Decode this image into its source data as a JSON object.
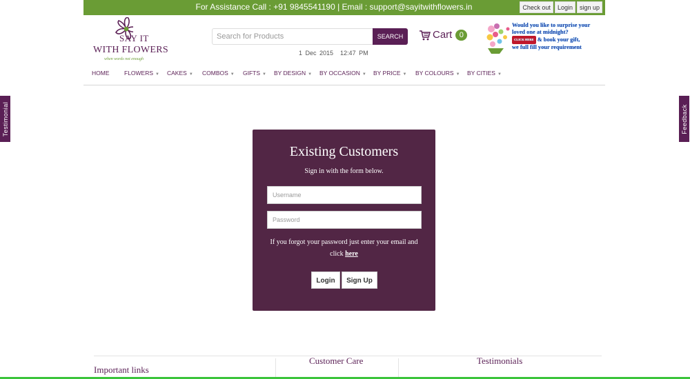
{
  "topbar": {
    "assistance": "For Assistance Call : +91 9845541190 | Email : support@sayitwithflowers.in",
    "links": [
      "Check out",
      "Login",
      "sign up"
    ]
  },
  "logo": {
    "line1": "SAY IT",
    "line2": "WITH FLOWERS",
    "tagline": "when words not enough"
  },
  "search": {
    "placeholder": "Search for Products",
    "button": "SEARCH"
  },
  "datetime": {
    "date": "1 Dec 2015",
    "time": "12:47 PM"
  },
  "cart": {
    "label": "Cart",
    "count": "0",
    "icon": "cart-icon"
  },
  "promo": {
    "line1": "Would you like to surprise your",
    "line2": "loved one at midnight?",
    "button": "CLICK HERE",
    "line3": "& book your gift,",
    "line4": "we full fill your requirement"
  },
  "nav": [
    {
      "label": "HOME",
      "caret": false
    },
    {
      "label": "FLOWERS",
      "caret": true
    },
    {
      "label": "CAKES",
      "caret": true
    },
    {
      "label": "COMBOS",
      "caret": true
    },
    {
      "label": "GIFTS",
      "caret": true
    },
    {
      "label": "BY DESIGN",
      "caret": true
    },
    {
      "label": "BY OCCASION",
      "caret": true
    },
    {
      "label": "BY PRICE",
      "caret": true
    },
    {
      "label": "BY COLOURS",
      "caret": true
    },
    {
      "label": "BY CITIES",
      "caret": true
    }
  ],
  "side_tabs": {
    "left": "Testimonial",
    "right": "Feedback"
  },
  "login": {
    "title": "Existing Customers",
    "subtitle": "Sign in with the form below.",
    "username_placeholder": "Username",
    "password_placeholder": "Password",
    "forgot_text": "If you forgot your password just enter your email and click",
    "forgot_link": "here",
    "login_button": "Login",
    "signup_button": "Sign Up"
  },
  "footer": {
    "important_links": "Important links",
    "customer_care": "Customer Care",
    "testimonials": "Testimonials"
  },
  "colors": {
    "brand_purple": "#5a1f55",
    "panel_purple": "#522645",
    "brand_green": "#6a9c35"
  }
}
